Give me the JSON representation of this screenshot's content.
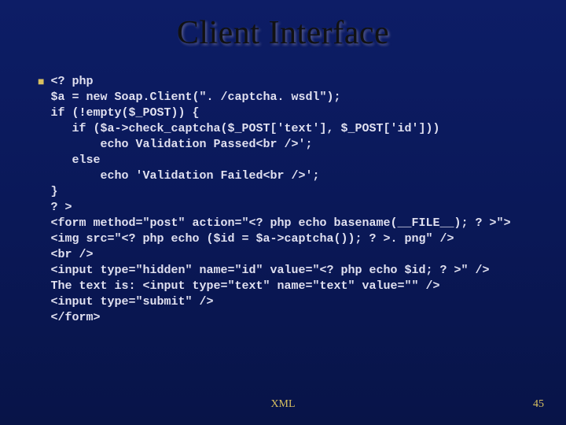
{
  "title": "Client Interface",
  "code": "<? php\n$a = new Soap.Client(\". /captcha. wsdl\");\nif (!empty($_POST)) {\n   if ($a->check_captcha($_POST['text'], $_POST['id']))\n       echo Validation Passed<br />';\n   else\n       echo 'Validation Failed<br />';\n}\n? >\n<form method=\"post\" action=\"<? php echo basename(__FILE__); ? >\">\n<img src=\"<? php echo ($id = $a->captcha()); ? >. png\" />\n<br />\n<input type=\"hidden\" name=\"id\" value=\"<? php echo $id; ? >\" />\nThe text is: <input type=\"text\" name=\"text\" value=\"\" />\n<input type=\"submit\" />\n</form>",
  "footer_center": "XML",
  "footer_right": "45"
}
